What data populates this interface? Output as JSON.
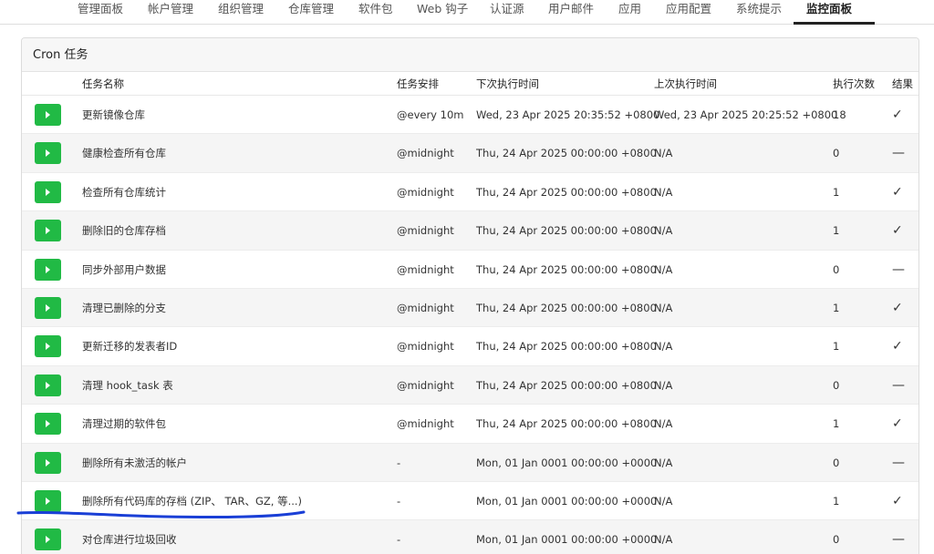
{
  "nav": {
    "tabs": [
      {
        "label": "管理面板"
      },
      {
        "label": "帐户管理"
      },
      {
        "label": "组织管理"
      },
      {
        "label": "仓库管理"
      },
      {
        "label": "软件包"
      },
      {
        "label": "Web 钩子"
      },
      {
        "label": "认证源"
      },
      {
        "label": "用户邮件"
      },
      {
        "label": "应用"
      },
      {
        "label": "应用配置"
      },
      {
        "label": "系统提示"
      },
      {
        "label": "监控面板"
      }
    ],
    "active": "监控面板"
  },
  "panel": {
    "title": "Cron 任务"
  },
  "table": {
    "headers": {
      "name": "任务名称",
      "schedule": "任务安排",
      "next": "下次执行时间",
      "prev": "上次执行时间",
      "count": "执行次数",
      "result": "结果"
    },
    "rows": [
      {
        "name": "更新镜像仓库",
        "schedule": "@every 10m",
        "next": "Wed, 23 Apr 2025 20:35:52 +0800",
        "prev": "Wed, 23 Apr 2025 20:25:52 +0800",
        "count": "18",
        "result": "✓"
      },
      {
        "name": "健康检查所有仓库",
        "schedule": "@midnight",
        "next": "Thu, 24 Apr 2025 00:00:00 +0800",
        "prev": "N/A",
        "count": "0",
        "result": "—"
      },
      {
        "name": "检查所有仓库统计",
        "schedule": "@midnight",
        "next": "Thu, 24 Apr 2025 00:00:00 +0800",
        "prev": "N/A",
        "count": "1",
        "result": "✓"
      },
      {
        "name": "删除旧的仓库存档",
        "schedule": "@midnight",
        "next": "Thu, 24 Apr 2025 00:00:00 +0800",
        "prev": "N/A",
        "count": "1",
        "result": "✓"
      },
      {
        "name": "同步外部用户数据",
        "schedule": "@midnight",
        "next": "Thu, 24 Apr 2025 00:00:00 +0800",
        "prev": "N/A",
        "count": "0",
        "result": "—"
      },
      {
        "name": "清理已删除的分支",
        "schedule": "@midnight",
        "next": "Thu, 24 Apr 2025 00:00:00 +0800",
        "prev": "N/A",
        "count": "1",
        "result": "✓"
      },
      {
        "name": "更新迁移的发表者ID",
        "schedule": "@midnight",
        "next": "Thu, 24 Apr 2025 00:00:00 +0800",
        "prev": "N/A",
        "count": "1",
        "result": "✓"
      },
      {
        "name": "清理 hook_task 表",
        "schedule": "@midnight",
        "next": "Thu, 24 Apr 2025 00:00:00 +0800",
        "prev": "N/A",
        "count": "0",
        "result": "—"
      },
      {
        "name": "清理过期的软件包",
        "schedule": "@midnight",
        "next": "Thu, 24 Apr 2025 00:00:00 +0800",
        "prev": "N/A",
        "count": "1",
        "result": "✓"
      },
      {
        "name": "删除所有未激活的帐户",
        "schedule": "-",
        "next": "Mon, 01 Jan 0001 00:00:00 +0000",
        "prev": "N/A",
        "count": "0",
        "result": "—"
      },
      {
        "name": "删除所有代码库的存档 (ZIP、 TAR、GZ, 等...)",
        "schedule": "-",
        "next": "Mon, 01 Jan 0001 00:00:00 +0000",
        "prev": "N/A",
        "count": "1",
        "result": "✓"
      },
      {
        "name": "对仓库进行垃圾回收",
        "schedule": "-",
        "next": "Mon, 01 Jan 0001 00:00:00 +0000",
        "prev": "N/A",
        "count": "0",
        "result": "—"
      }
    ]
  },
  "colors": {
    "run_button": "#21ba45",
    "annotation_stroke": "#1a3fd6"
  }
}
